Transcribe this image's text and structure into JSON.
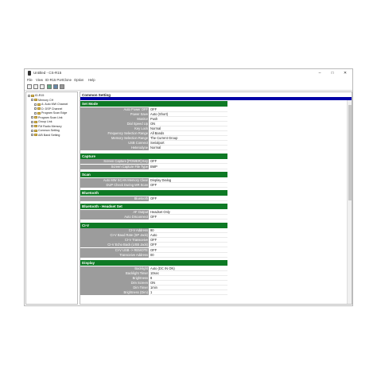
{
  "window": {
    "title": "Untitled - CS-R15"
  },
  "menubar": {
    "items": [
      "File",
      "View",
      "ID-R15 Port",
      "Clone",
      "Option",
      "Help"
    ]
  },
  "tree": {
    "items": [
      {
        "label": "ID-R15",
        "level": 0
      },
      {
        "label": "Memory CH",
        "level": 1
      },
      {
        "label": "A: Auto MW Channel",
        "level": 2
      },
      {
        "label": "D: DSP Channel",
        "level": 2
      },
      {
        "label": "Program Scan Edge",
        "level": 2
      },
      {
        "label": "Program Scan Link",
        "level": 1
      },
      {
        "label": "Group Link",
        "level": 1
      },
      {
        "label": "FM Radio Memory",
        "level": 1
      },
      {
        "label": "Common Setting",
        "level": 1
      },
      {
        "label": "A/B Band Setting",
        "level": 1
      }
    ]
  },
  "content": {
    "header": "Common Setting",
    "sections": [
      {
        "title": "Set Mode",
        "rows": [
          {
            "label": "Auto Power OFF",
            "value": "OFF"
          },
          {
            "label": "Power Save",
            "value": "Auto (Short)"
          },
          {
            "label": "Monitor",
            "value": "Push"
          },
          {
            "label": "Dial Speed Up",
            "value": "ON"
          },
          {
            "label": "Key Lock",
            "value": "Normal"
          },
          {
            "label": "Frequency Selection Range",
            "value": "All Bands"
          },
          {
            "label": "Memory Selection Range",
            "value": "The Current Group"
          },
          {
            "label": "USB Connect",
            "value": "Serialport"
          },
          {
            "label": "Heterodyne",
            "value": "Normal"
          }
        ]
      },
      {
        "title": "Capture",
        "rows": [
          {
            "label": "Screen Capture [POWER] Key",
            "value": "OFF"
          },
          {
            "label": "Screen Capture File Type",
            "value": "BMP"
          }
        ]
      },
      {
        "title": "Scan",
        "rows": [
          {
            "label": "Auto MW SCAN Memory Clear",
            "value": "Display Dialog"
          },
          {
            "label": "DUP Check During MR Scan",
            "value": "OFF"
          }
        ]
      },
      {
        "title": "Bluetooth",
        "rows": [
          {
            "label": "Bluetooth",
            "value": "OFF"
          }
        ]
      },
      {
        "title": "Bluetooth - Headset Set",
        "rows": [
          {
            "label": "AF Output",
            "value": "Headset Only"
          },
          {
            "label": "Auto Disconnect",
            "value": "OFF"
          }
        ]
      },
      {
        "title": "CI-V",
        "rows": [
          {
            "label": "CI-V Address",
            "value": "80"
          },
          {
            "label": "CI-V Baud Rate (SP Jack)",
            "value": "Auto"
          },
          {
            "label": "CI-V Transceive",
            "value": "OFF"
          },
          {
            "label": "CI-V Echo Back (USB Jack)",
            "value": "OFF"
          },
          {
            "label": "CI-V USB -> REMOTE",
            "value": "OFF"
          },
          {
            "label": "Transceive Address",
            "value": "00"
          }
        ]
      },
      {
        "title": "Display",
        "rows": [
          {
            "label": "Backlight",
            "value": "Auto (DC IN ON)"
          },
          {
            "label": "Backlight Timer",
            "value": "10sec"
          },
          {
            "label": "Brightness",
            "value": "8"
          },
          {
            "label": "Dim Screen",
            "value": "ON"
          },
          {
            "label": "Dim Timer",
            "value": "1min"
          },
          {
            "label": "Brightness (Dim)",
            "value": "1"
          }
        ]
      }
    ]
  },
  "colors": {
    "section_green": "#0e7a25",
    "label_gray": "#9c9c9c",
    "header_blue": "#0000a8"
  }
}
